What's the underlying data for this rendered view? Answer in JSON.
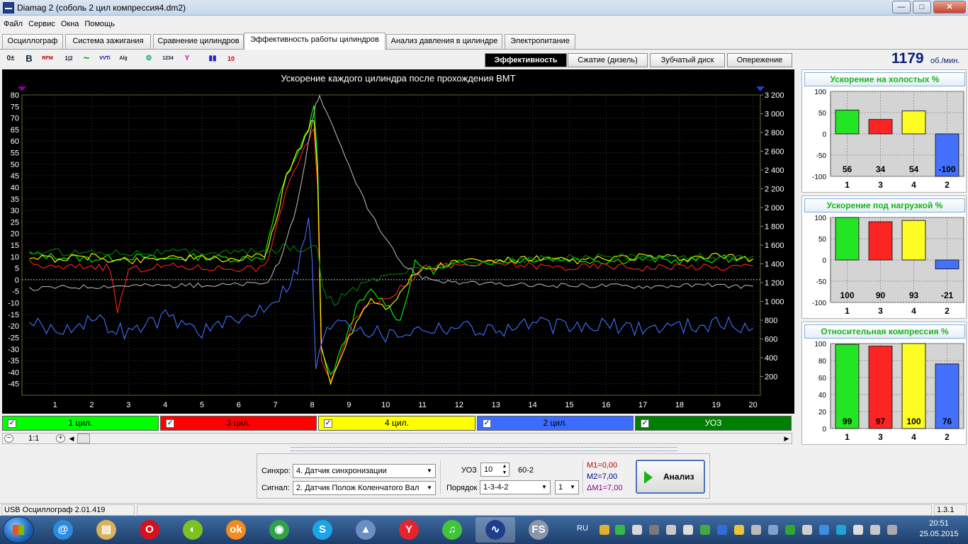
{
  "window": {
    "title": "Diamag 2 (соболь 2 цил компрессия4.dm2)",
    "min_label": "—",
    "max_label": "□",
    "close_label": "✕"
  },
  "menu": [
    "Файл",
    "Сервис",
    "Окна",
    "Помощь"
  ],
  "tabs": [
    {
      "label": "Осциллограф",
      "active": false
    },
    {
      "label": "Система зажигания",
      "active": false
    },
    {
      "label": "Сравнение цилиндров",
      "active": false
    },
    {
      "label": "Эффективность работы цилиндров",
      "active": true
    },
    {
      "label": "Анализ давления в цилиндре",
      "active": false
    },
    {
      "label": "Электропитание",
      "active": false
    }
  ],
  "toolbar": {
    "buttons": [
      {
        "label": "0±",
        "icon": "offset-icon"
      },
      {
        "label": "B",
        "icon": "bold-b-icon"
      },
      {
        "label": "RPM",
        "icon": "rpm-gauge-icon"
      },
      {
        "label": "1|2",
        "icon": "cylinder-order-icon"
      },
      {
        "label": "~",
        "icon": "waveform-icon"
      },
      {
        "label": "VVTi",
        "icon": "vvti-icon"
      },
      {
        "label": "Alg 1/2",
        "icon": "algorithm-icon"
      },
      {
        "label": "⚙",
        "icon": "sensor-icon"
      },
      {
        "label": "1234",
        "icon": "numbering-icon"
      },
      {
        "label": "Y",
        "icon": "filter-icon"
      },
      {
        "label": "▮▮",
        "icon": "bar-chart-icon"
      },
      {
        "label": "10",
        "icon": "scale-icon"
      }
    ]
  },
  "modes": [
    {
      "label": "Эффективность",
      "active": true
    },
    {
      "label": "Сжатие (дизель)",
      "active": false
    },
    {
      "label": "Зубчатый диск",
      "active": false
    },
    {
      "label": "Опережение",
      "active": false
    }
  ],
  "rpm": {
    "value": "1179",
    "unit": "об./мин."
  },
  "chart_data": {
    "type": "line",
    "title": "Ускорение каждого цилиндра после прохождения ВМТ",
    "x_ticks": [
      "1",
      "2",
      "3",
      "4",
      "5",
      "6",
      "7",
      "8",
      "9",
      "10",
      "11",
      "12",
      "13",
      "14",
      "15",
      "16",
      "17",
      "18",
      "19",
      "20"
    ],
    "xlim": [
      0.1,
      20.2
    ],
    "y_left_ticks": [
      "80",
      "75",
      "70",
      "65",
      "60",
      "55",
      "50",
      "45",
      "40",
      "35",
      "30",
      "25",
      "20",
      "15",
      "10",
      "5",
      "0",
      "-5",
      "-10",
      "-15",
      "-20",
      "-25",
      "-30",
      "-35",
      "-40",
      "-45"
    ],
    "y_left_lim": [
      -50,
      80
    ],
    "y_right_ticks": [
      "3 200",
      "3 000",
      "2 800",
      "2 600",
      "2 400",
      "2 200",
      "2 000",
      "1 800",
      "1 600",
      "1 400",
      "1 200",
      "1 000",
      "800",
      "600",
      "400",
      "200"
    ],
    "y_right_lim": [
      0,
      3200
    ],
    "grid": true,
    "series": [
      {
        "name": "1 цил.",
        "color": "#00ff00",
        "axis": "left",
        "x": [
          0.3,
          1,
          2,
          3,
          4,
          5,
          6,
          6.7,
          7,
          7.3,
          7.6,
          7.9,
          8.05,
          8.15,
          8.25,
          8.5,
          8.8,
          9.2,
          9.6,
          10,
          10.4,
          10.8,
          11.3,
          12,
          13,
          14,
          15,
          16,
          17,
          18,
          19,
          20
        ],
        "y": [
          11,
          10,
          9,
          10,
          9,
          10,
          9,
          10,
          30,
          45,
          55,
          65,
          75,
          50,
          -30,
          -42,
          -30,
          -12,
          -5,
          -10,
          -18,
          7,
          4,
          7,
          8,
          9,
          9,
          8,
          9,
          8,
          9,
          9
        ]
      },
      {
        "name": "3 цил.",
        "color": "#ff2020",
        "axis": "left",
        "x": [
          0.3,
          1,
          2,
          2.5,
          2.7,
          3,
          4,
          5,
          6,
          6.7,
          7,
          7.3,
          7.6,
          7.9,
          8.05,
          8.15,
          8.25,
          8.5,
          8.8,
          9.2,
          9.6,
          10,
          10.4,
          11,
          12,
          13,
          14,
          15,
          16,
          17,
          18,
          19,
          20
        ],
        "y": [
          7,
          5,
          6,
          5,
          -14,
          4,
          6,
          5,
          5,
          5,
          20,
          40,
          50,
          60,
          65,
          40,
          -35,
          -45,
          -30,
          -15,
          -10,
          -8,
          -4,
          5,
          6,
          7,
          6,
          5,
          6,
          5,
          6,
          5,
          6
        ]
      },
      {
        "name": "4 цил.",
        "color": "#ffff00",
        "axis": "left",
        "x": [
          0.3,
          1,
          2,
          3,
          4,
          5,
          6,
          6.7,
          7,
          7.3,
          7.6,
          7.9,
          8.05,
          8.15,
          8.25,
          8.5,
          8.8,
          9.2,
          9.6,
          10,
          10.4,
          10.8,
          11.5,
          12,
          13,
          14,
          15,
          16,
          17,
          18,
          19,
          20
        ],
        "y": [
          10,
          9,
          10,
          8,
          10,
          9,
          9,
          10,
          25,
          45,
          55,
          65,
          70,
          45,
          -30,
          -45,
          -32,
          -18,
          -8,
          -12,
          -6,
          3,
          6,
          8,
          8,
          9,
          8,
          9,
          10,
          9,
          10,
          9
        ]
      },
      {
        "name": "2 цил.",
        "color": "#4070ff",
        "axis": "left",
        "x": [
          0.3,
          1,
          2,
          3,
          4,
          5,
          6,
          6.8,
          7.2,
          7.6,
          7.9,
          8.0,
          8.1,
          8.3,
          8.7,
          9.2,
          10,
          11,
          12,
          13,
          14,
          15,
          16,
          17,
          18,
          19,
          20
        ],
        "y": [
          -18,
          -22,
          -17,
          -23,
          -16,
          -22,
          -18,
          -10,
          -5,
          5,
          25,
          10,
          -40,
          -25,
          -15,
          -20,
          -24,
          -21,
          -20,
          -22,
          -19,
          -21,
          -20,
          -21,
          -20,
          -19,
          -21
        ]
      },
      {
        "name": "УОЗ",
        "color": "#008000",
        "axis": "left",
        "x": [
          0.3,
          2,
          4,
          6,
          6.9,
          7.3,
          7.7,
          8.0,
          8.15,
          8.3,
          8.6,
          9,
          10,
          11,
          12,
          14,
          16,
          18,
          20
        ],
        "y": [
          12,
          12,
          12,
          12,
          12,
          15,
          12,
          16,
          14,
          -5,
          -10,
          -5,
          2,
          5,
          7,
          9,
          10,
          10,
          10
        ]
      },
      {
        "name": "об./мин.",
        "color": "#b0b0b0",
        "axis": "right",
        "x": [
          0.3,
          1,
          2,
          3,
          4,
          5,
          6,
          6.8,
          7.2,
          7.6,
          7.9,
          8.1,
          8.2,
          8.5,
          9,
          9.5,
          10,
          10.5,
          11,
          11.5,
          12,
          13,
          14,
          15,
          16,
          17,
          18,
          19,
          20
        ],
        "y": [
          1130,
          1150,
          1160,
          1170,
          1170,
          1170,
          1180,
          1200,
          1500,
          2050,
          2700,
          3100,
          3200,
          2900,
          2450,
          2000,
          1650,
          1380,
          1260,
          1220,
          1200,
          1180,
          1170,
          1170,
          1170,
          1160,
          1170,
          1170,
          1160
        ]
      }
    ]
  },
  "legend": [
    {
      "label": "1 цил.",
      "color": "#00ff00",
      "checked": true
    },
    {
      "label": "3 цил.",
      "color": "#ff0000",
      "checked": true
    },
    {
      "label": "4 цил.",
      "color": "#ffff00",
      "checked": true
    },
    {
      "label": "2 цил.",
      "color": "#3b6cff",
      "checked": true
    },
    {
      "label": "УОЗ",
      "color": "#008000",
      "checked": true
    }
  ],
  "scroll": {
    "zoom_label": "1:1",
    "minus": "−",
    "plus": "+"
  },
  "controls": {
    "sync_label": "Синхро:",
    "sync_value": "4.  Датчик синхронизации",
    "signal_label": "Сигнал:",
    "signal_value": "2.  Датчик Полож Коленчатого Вал",
    "uoz_label": "УОЗ",
    "uoz_value": "10",
    "gear": "60-2",
    "order_label": "Порядок",
    "order_value": "1-3-4-2",
    "order_num": "1",
    "m1": "M1=0,00",
    "m2": "M2=7,00",
    "dm": "ΔM1=7,00",
    "analyze_label": "Анализ"
  },
  "panels": [
    {
      "title": "Ускорение на холостых %",
      "yticks": [
        "100",
        "50",
        "0",
        "-50",
        "-100"
      ],
      "ylim": [
        -100,
        100
      ],
      "bars": [
        {
          "cat": "1",
          "value": 56,
          "label": "56",
          "color": "#19e619"
        },
        {
          "cat": "3",
          "value": 34,
          "label": "34",
          "color": "#ff1a1a"
        },
        {
          "cat": "4",
          "value": 54,
          "label": "54",
          "color": "#ffff1a"
        },
        {
          "cat": "2",
          "value": -100,
          "label": "-100",
          "color": "#3b6cff"
        }
      ]
    },
    {
      "title": "Ускорение под нагрузкой %",
      "yticks": [
        "100",
        "50",
        "0",
        "-50",
        "-100"
      ],
      "ylim": [
        -100,
        100
      ],
      "bars": [
        {
          "cat": "1",
          "value": 100,
          "label": "100",
          "color": "#19e619"
        },
        {
          "cat": "3",
          "value": 90,
          "label": "90",
          "color": "#ff1a1a"
        },
        {
          "cat": "4",
          "value": 93,
          "label": "93",
          "color": "#ffff1a"
        },
        {
          "cat": "2",
          "value": -21,
          "label": "-21",
          "color": "#3b6cff"
        }
      ]
    },
    {
      "title": "Относительная компрессия %",
      "yticks": [
        "100",
        "80",
        "60",
        "40",
        "20",
        "0"
      ],
      "ylim": [
        0,
        100
      ],
      "bars": [
        {
          "cat": "1",
          "value": 99,
          "label": "99",
          "color": "#19e619"
        },
        {
          "cat": "3",
          "value": 97,
          "label": "97",
          "color": "#ff1a1a"
        },
        {
          "cat": "4",
          "value": 100,
          "label": "100",
          "color": "#ffff1a"
        },
        {
          "cat": "2",
          "value": 76,
          "label": "76",
          "color": "#3b6cff"
        }
      ]
    }
  ],
  "status": {
    "left": "USB Осциллограф  2.01.419",
    "right": "1.3.1"
  },
  "taskbar": {
    "apps": [
      {
        "name": "mail-app-icon",
        "glyph": "@",
        "color": "#2a8be0"
      },
      {
        "name": "file-manager-icon",
        "glyph": "▤",
        "color": "#d9b25a"
      },
      {
        "name": "opera-browser-icon",
        "glyph": "O",
        "color": "#d4111e"
      },
      {
        "name": "media-app-icon",
        "glyph": "◐",
        "color": "#7cc321"
      },
      {
        "name": "odnoklassniki-icon",
        "glyph": "ok",
        "color": "#f28a1d"
      },
      {
        "name": "chrome-browser-icon",
        "glyph": "◉",
        "color": "#2fa34a"
      },
      {
        "name": "skype-icon",
        "glyph": "S",
        "color": "#1ca4e8"
      },
      {
        "name": "app-triangle-icon",
        "glyph": "▲",
        "color": "#6a8fc0"
      },
      {
        "name": "yandex-browser-icon",
        "glyph": "Y",
        "color": "#e8232b"
      },
      {
        "name": "music-app-icon",
        "glyph": "♫",
        "color": "#42c43a"
      },
      {
        "name": "diamag-app-icon",
        "glyph": "∿",
        "color": "#1f3f8c"
      },
      {
        "name": "fs-app-icon",
        "glyph": "FS",
        "color": "#8a97aa"
      }
    ],
    "lang": "RU",
    "time": "20:51",
    "date": "25.05.2015"
  }
}
